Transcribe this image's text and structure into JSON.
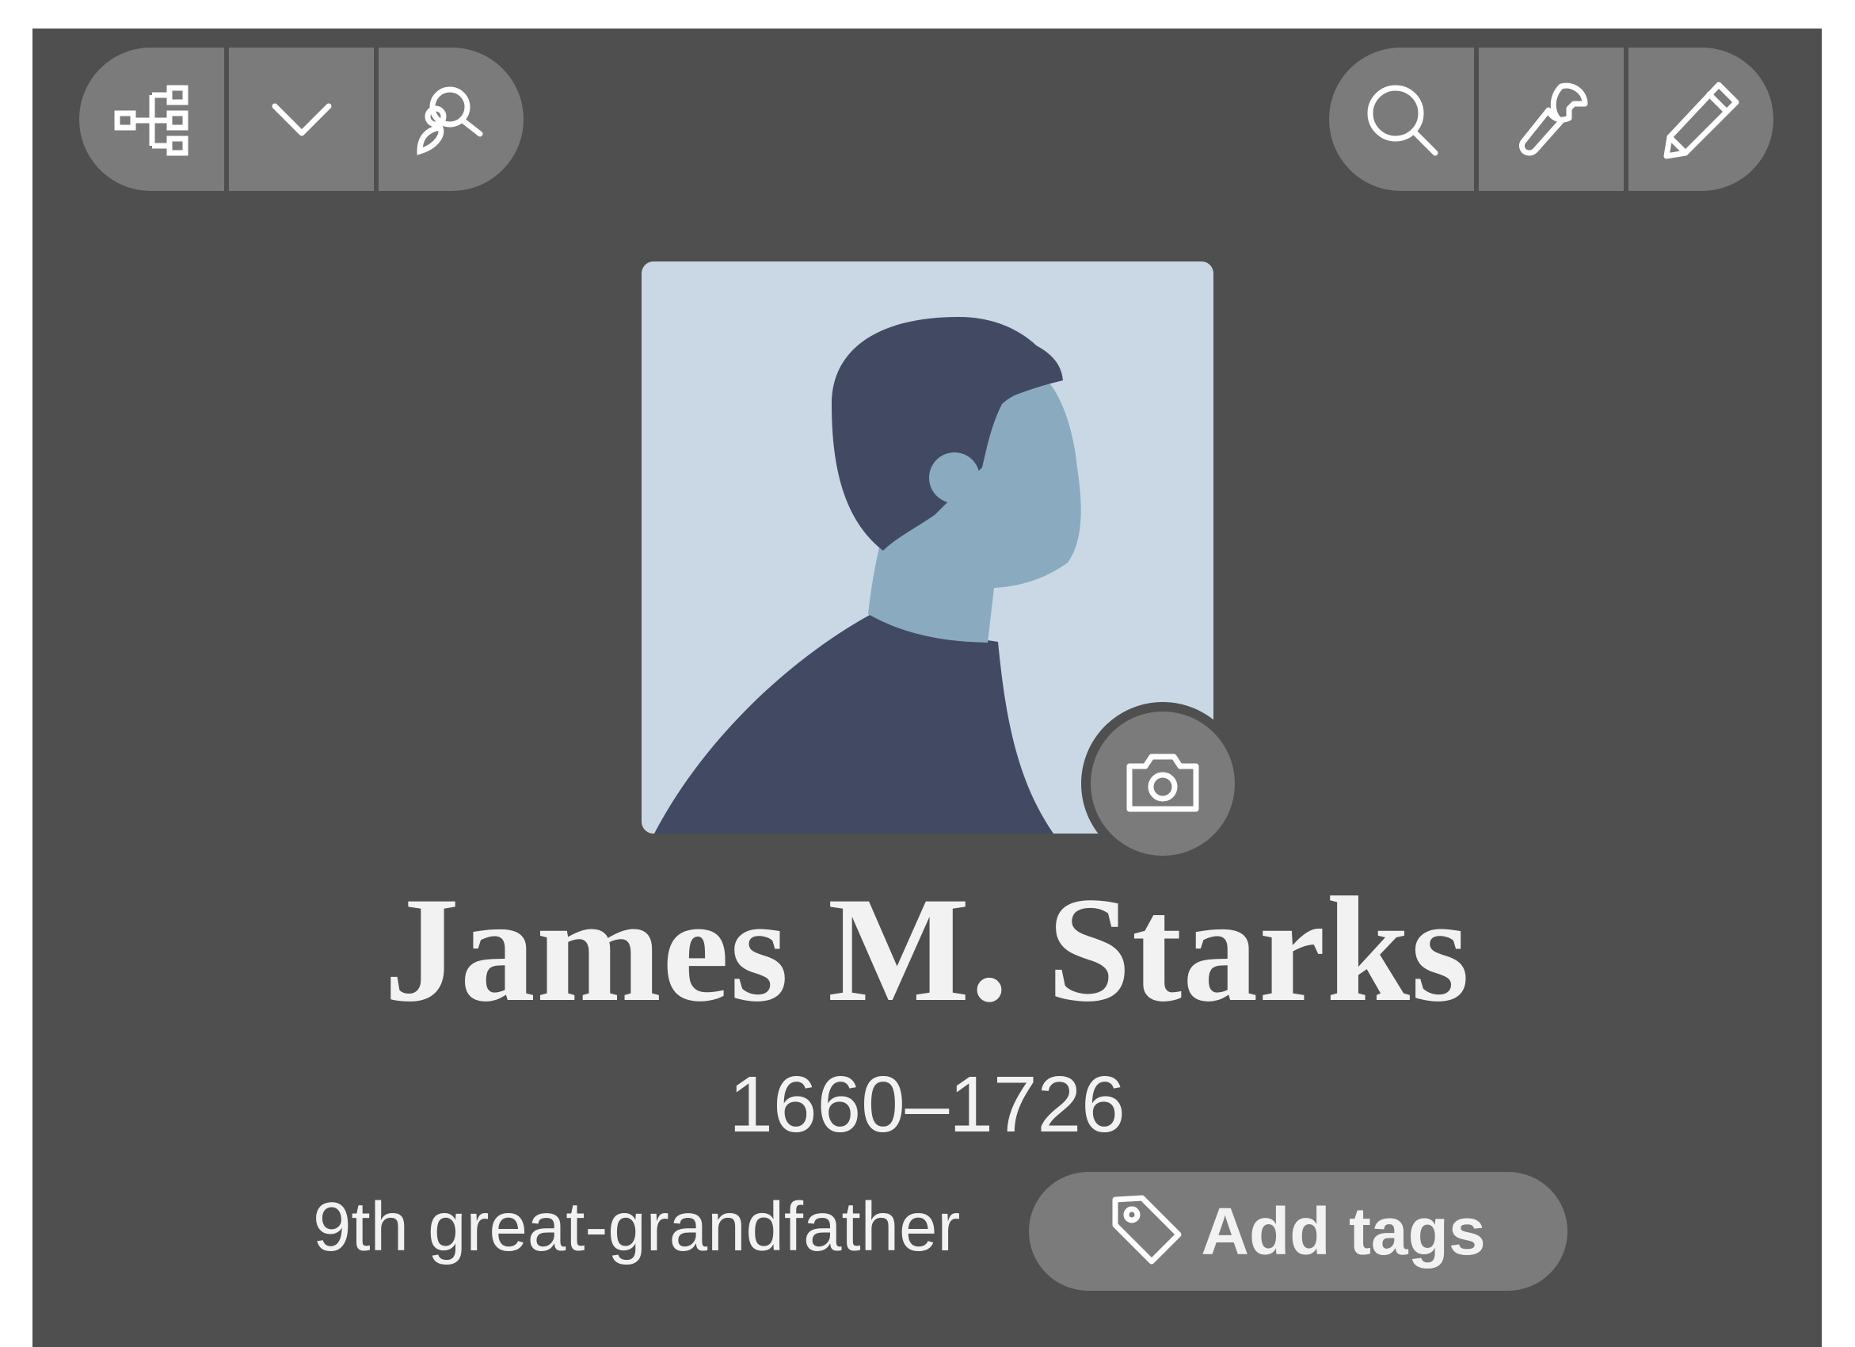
{
  "colors": {
    "panel_bg": "#4f4f4f",
    "button_bg": "#7b7b7b",
    "text": "#f2f2f2",
    "avatar_bg": "#c9d8e4",
    "avatar_dark": "#424a63",
    "avatar_skin": "#8aabbf"
  },
  "toolbar": {
    "left_icons": [
      "family-tree-icon",
      "chevron-down-icon",
      "person-search-icon"
    ],
    "right_icons": [
      "search-icon",
      "wrench-icon",
      "pencil-icon"
    ]
  },
  "profile": {
    "avatar_icon": "person-silhouette",
    "camera_icon": "camera-icon",
    "name": "James M. Starks",
    "dates": "1660–1726",
    "relationship": "9th great-grandfather",
    "tags_icon": "tag-icon",
    "tags_label": "Add tags"
  }
}
